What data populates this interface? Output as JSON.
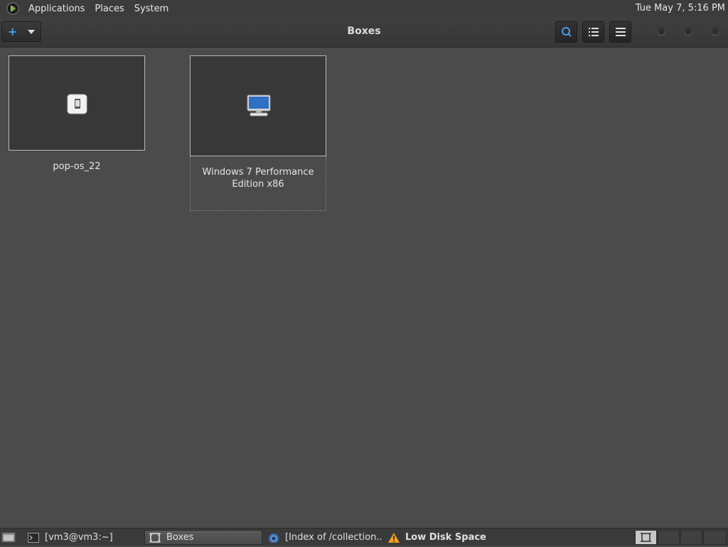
{
  "top_panel": {
    "menus": [
      "Applications",
      "Places",
      "System"
    ],
    "clock": "Tue May  7,  5:16 PM"
  },
  "header": {
    "title": "Boxes",
    "new_button_label": "+",
    "buttons": [
      "search",
      "select",
      "menu"
    ]
  },
  "boxes": [
    {
      "name": "pop-os_22",
      "icon": "mobile-device-icon"
    },
    {
      "name": "Windows 7 Performance Edition x86",
      "icon": "computer-monitor-icon",
      "selected": true
    }
  ],
  "taskbar": {
    "tasks": [
      {
        "label": "[vm3@vm3:~]",
        "icon": "terminal-icon"
      },
      {
        "label": "Boxes",
        "icon": "boxes-icon",
        "active": true
      },
      {
        "label": "[Index of /collection...",
        "icon": "browser-icon"
      },
      {
        "label": "Low Disk Space",
        "icon": "warning-icon",
        "bold": true
      }
    ]
  },
  "colors": {
    "accent_blue": "#4a9ee8",
    "background": "#4b4b4b",
    "warning": "#f0a020"
  }
}
